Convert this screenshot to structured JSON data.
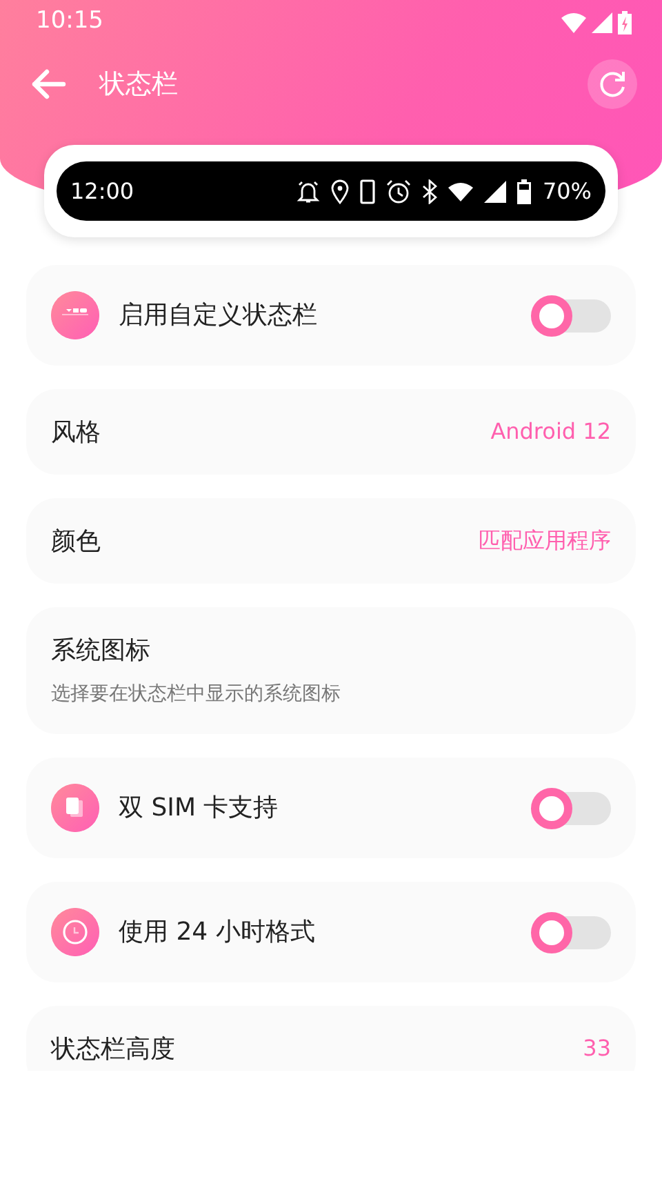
{
  "status_bar": {
    "time": "10:15"
  },
  "app_bar": {
    "title": "状态栏"
  },
  "preview": {
    "time": "12:00",
    "battery": "70%"
  },
  "settings": [
    {
      "kind": "switch",
      "label": "启用自定义状态栏",
      "on": false
    },
    {
      "kind": "value",
      "label": "风格",
      "value": "Android 12"
    },
    {
      "kind": "value",
      "label": "颜色",
      "value": "匹配应用程序"
    },
    {
      "kind": "detail",
      "label": "系统图标",
      "description": "选择要在状态栏中显示的系统图标"
    },
    {
      "kind": "switch",
      "label": "双 SIM 卡支持",
      "on": false
    },
    {
      "kind": "switch",
      "label": "使用 24 小时格式",
      "on": false
    },
    {
      "kind": "value",
      "label": "状态栏高度",
      "value": "33"
    }
  ]
}
